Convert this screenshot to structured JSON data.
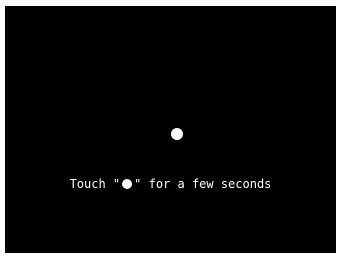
{
  "calibration": {
    "instruction_prefix": "Touch \"",
    "instruction_suffix": "\" for a few seconds",
    "target_icon": "filled-circle-icon",
    "background_color": "#000000",
    "foreground_color": "#ffffff"
  }
}
